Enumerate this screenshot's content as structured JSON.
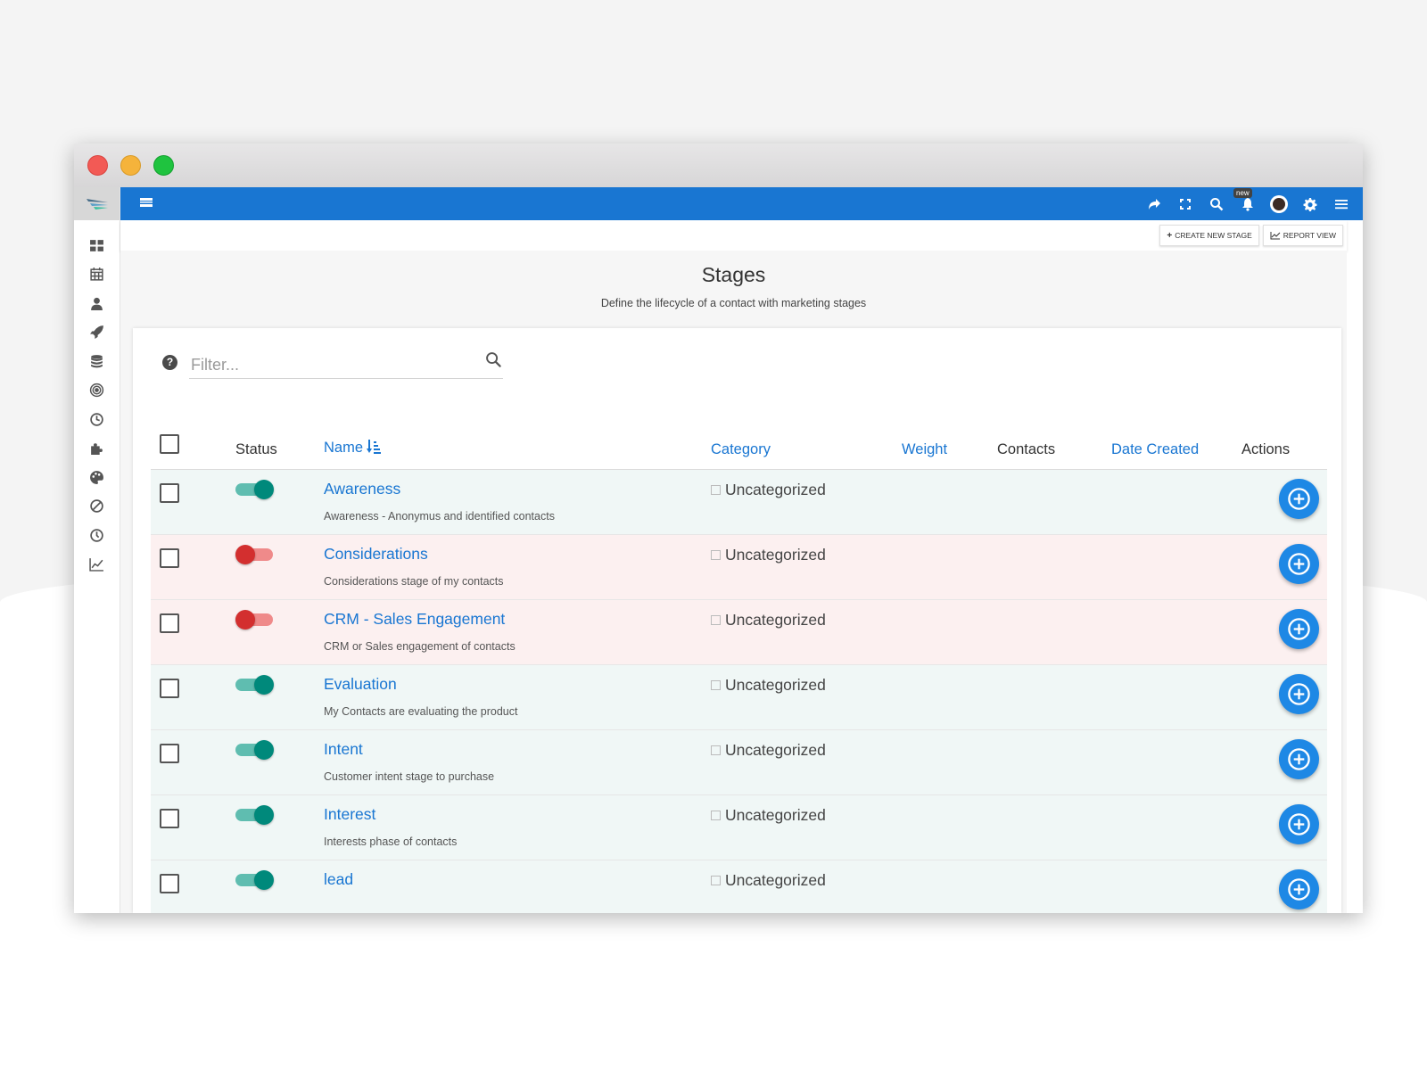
{
  "header": {
    "new_badge": "new"
  },
  "toolbar": {
    "create_label": "CREATE NEW STAGE",
    "report_label": "REPORT VIEW"
  },
  "page": {
    "title": "Stages",
    "subtitle": "Define the lifecycle of a contact with marketing stages"
  },
  "filter": {
    "placeholder": "Filter..."
  },
  "columns": {
    "status": "Status",
    "name": "Name",
    "category": "Category",
    "weight": "Weight",
    "contacts": "Contacts",
    "date_created": "Date Created",
    "actions": "Actions"
  },
  "rows": [
    {
      "name": "Awareness",
      "description": "Awareness - Anonymus and identified contacts",
      "category": "Uncategorized",
      "published": true
    },
    {
      "name": "Considerations",
      "description": "Considerations stage of my contacts",
      "category": "Uncategorized",
      "published": false
    },
    {
      "name": "CRM - Sales Engagement",
      "description": "CRM or Sales engagement of contacts",
      "category": "Uncategorized",
      "published": false
    },
    {
      "name": "Evaluation",
      "description": "My Contacts are evaluating the product",
      "category": "Uncategorized",
      "published": true
    },
    {
      "name": "Intent",
      "description": "Customer intent stage to purchase",
      "category": "Uncategorized",
      "published": true
    },
    {
      "name": "Interest",
      "description": "Interests phase of contacts",
      "category": "Uncategorized",
      "published": true
    },
    {
      "name": "lead",
      "description": "",
      "category": "Uncategorized",
      "published": true
    }
  ],
  "colors": {
    "primary": "#1976d2",
    "toggle_on": "#00897b",
    "toggle_off": "#d32f2f",
    "row_on_bg": "#f0f7f6",
    "row_off_bg": "#fcf0f0"
  },
  "icons": {
    "sidebar": [
      "dashboard-icon",
      "calendar-icon",
      "user-icon",
      "rocket-icon",
      "database-icon",
      "target-icon",
      "clock-icon",
      "puzzle-icon",
      "palette-icon",
      "ban-icon",
      "history-icon",
      "chart-line-icon"
    ],
    "topnav": [
      "share-icon",
      "fullscreen-icon",
      "search-icon",
      "bell-icon",
      "avatar",
      "gear-icon",
      "menu-icon"
    ]
  }
}
